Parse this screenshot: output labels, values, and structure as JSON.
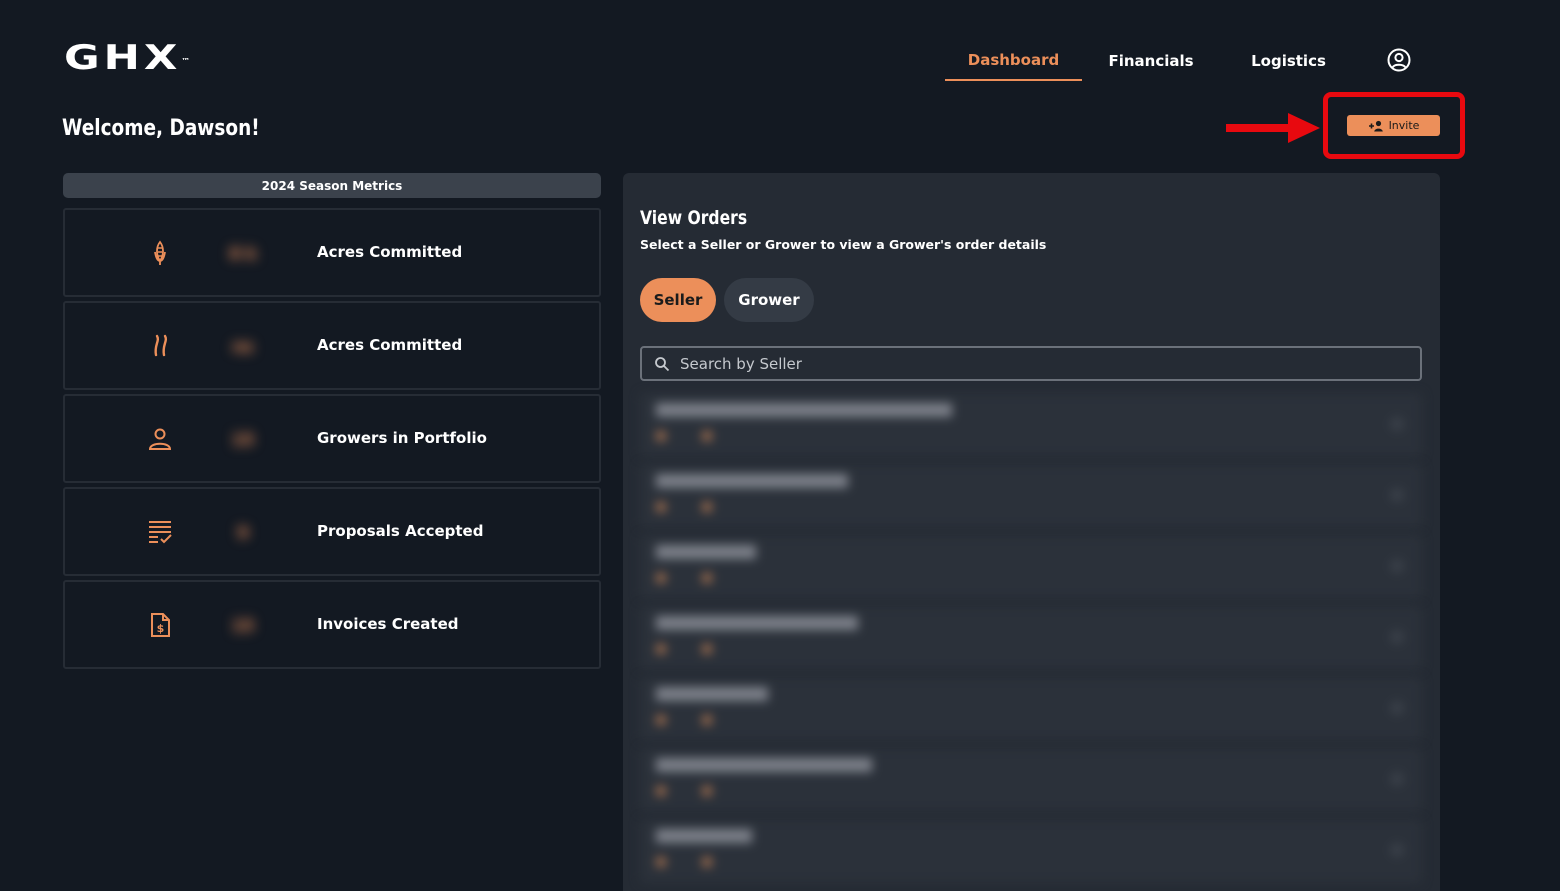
{
  "header": {
    "logo_text": "GHX",
    "logo_tm": "™",
    "nav_tabs": [
      {
        "label": "Dashboard",
        "active": true
      },
      {
        "label": "Financials",
        "active": false
      },
      {
        "label": "Logistics",
        "active": false
      }
    ],
    "account_icon": "account-circle-icon"
  },
  "welcome": "Welcome, Dawson!",
  "invite": {
    "label": "Invite",
    "icon": "add-user-icon",
    "annotation": {
      "arrow_color": "#e8090f",
      "box_color": "#e8090f"
    }
  },
  "metrics": {
    "title": "2024 Season Metrics",
    "cards": [
      {
        "icon": "corn-icon",
        "value": "8 k",
        "label": "Acres Committed"
      },
      {
        "icon": "wheat-icon",
        "value": "ns",
        "label": "Acres Committed"
      },
      {
        "icon": "person-icon",
        "value": "15",
        "label": "Growers in Portfolio"
      },
      {
        "icon": "checklist-icon",
        "value": "9",
        "label": "Proposals Accepted"
      },
      {
        "icon": "invoice-icon",
        "value": "15",
        "label": "Invoices Created"
      }
    ]
  },
  "orders": {
    "title": "View Orders",
    "subtitle": "Select a Seller or Grower to view a Grower's order details",
    "toggle": [
      {
        "label": "Seller",
        "active": true
      },
      {
        "label": "Grower",
        "active": false
      }
    ],
    "search": {
      "placeholder": "Search by Seller",
      "value": ""
    },
    "items": [
      {
        "name": "",
        "meta1": "",
        "meta2": ""
      },
      {
        "name": "",
        "meta1": "",
        "meta2": ""
      },
      {
        "name": "",
        "meta1": "",
        "meta2": ""
      },
      {
        "name": "",
        "meta1": "",
        "meta2": ""
      },
      {
        "name": "",
        "meta1": "",
        "meta2": ""
      },
      {
        "name": "",
        "meta1": "",
        "meta2": ""
      },
      {
        "name": "",
        "meta1": "",
        "meta2": ""
      }
    ]
  },
  "colors": {
    "background": "#131922",
    "panel": "#252b34",
    "accent": "#ec8f5a",
    "annotation": "#e8090f"
  }
}
